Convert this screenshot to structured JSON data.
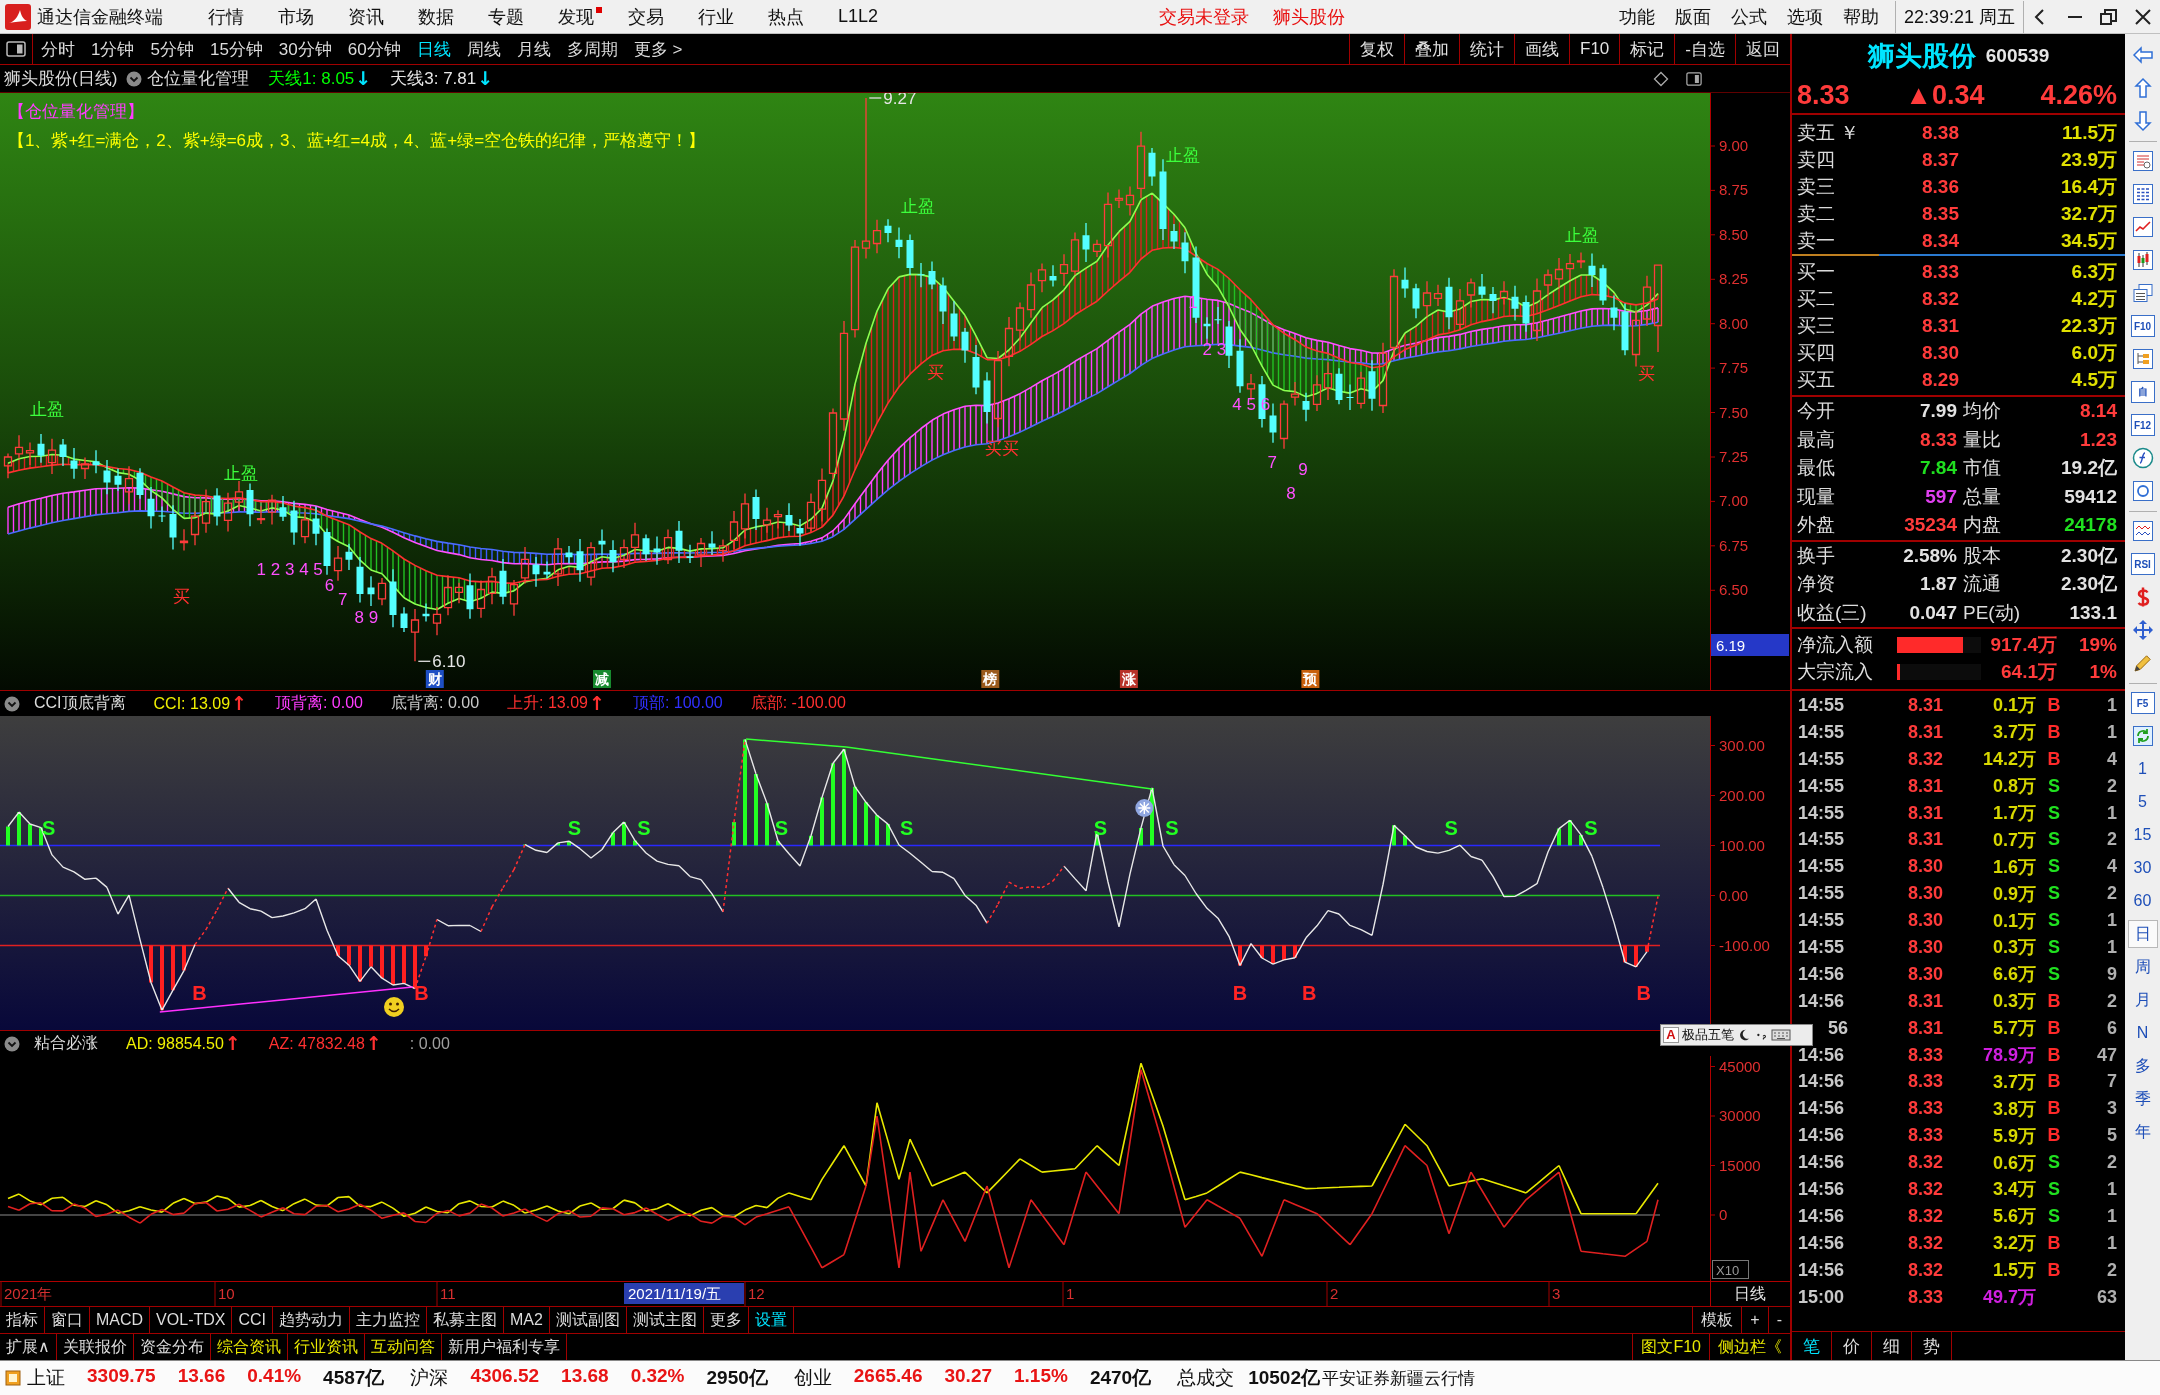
{
  "menu_bar": {
    "title": "通达信金融终端",
    "items": [
      {
        "label": "行情",
        "dot": false
      },
      {
        "label": "市场",
        "dot": false
      },
      {
        "label": "资讯",
        "dot": false
      },
      {
        "label": "数据",
        "dot": false
      },
      {
        "label": "专题",
        "dot": false
      },
      {
        "label": "发现",
        "dot": true
      },
      {
        "label": "交易",
        "dot": false
      },
      {
        "label": "行业",
        "dot": false
      },
      {
        "label": "热点",
        "dot": false
      },
      {
        "label": "L1L2",
        "dot": false
      }
    ],
    "alerts": [
      "交易未登录",
      "狮头股份"
    ],
    "right_items": [
      "功能",
      "版面",
      "公式",
      "选项",
      "帮助"
    ],
    "clock": "22:39:21 周五"
  },
  "period_bar": {
    "periods": [
      {
        "label": "分时",
        "selected": false
      },
      {
        "label": "1分钟",
        "selected": false
      },
      {
        "label": "5分钟",
        "selected": false
      },
      {
        "label": "15分钟",
        "selected": false
      },
      {
        "label": "30分钟",
        "selected": false
      },
      {
        "label": "60分钟",
        "selected": false
      },
      {
        "label": "日线",
        "selected": true
      },
      {
        "label": "周线",
        "selected": false
      },
      {
        "label": "月线",
        "selected": false
      },
      {
        "label": "多周期",
        "selected": false
      },
      {
        "label": "更多 >",
        "selected": false
      }
    ],
    "actions": [
      "复权",
      "叠加",
      "统计",
      "画线",
      "F10",
      "标记",
      "-自选",
      "返回"
    ]
  },
  "price_pane": {
    "title": "狮头股份(日线)",
    "indicator": "仓位量化管理",
    "readouts": [
      {
        "text": "天线1: 8.05",
        "color": "#00ff00",
        "arrow": {
          "text": "↓",
          "color": "#00e5ff"
        }
      },
      {
        "text": "天线3: 7.81",
        "color": "#e6e6e6",
        "arrow": {
          "text": "↓",
          "color": "#00e5ff"
        }
      }
    ],
    "notes": [
      {
        "text": "【仓位量化管理】",
        "color": "#ff3cff"
      },
      {
        "text": "【1、紫+红=满仓，2、紫+绿=6成，3、蓝+红=4成，4、蓝+绿=空仓铁的纪律，严格遵守！】",
        "color": "#ffff00"
      }
    ],
    "annotations": [
      {
        "text": "止盈",
        "kind": "take-profit"
      },
      {
        "text": "买",
        "kind": "buy"
      },
      {
        "text": "止盈",
        "kind": "take-profit"
      },
      {
        "text": "1 2 3 4 5",
        "kind": "count"
      },
      {
        "text": "6",
        "kind": "count"
      },
      {
        "text": "7",
        "kind": "count"
      },
      {
        "text": "8 9",
        "kind": "count"
      },
      {
        "text": "6.10",
        "kind": "price"
      },
      {
        "text": "9.27",
        "kind": "price"
      },
      {
        "text": "止盈",
        "kind": "take-profit"
      },
      {
        "text": "买",
        "kind": "buy"
      },
      {
        "text": "买买",
        "kind": "buy"
      },
      {
        "text": "止盈",
        "kind": "take-profit"
      },
      {
        "text": "1",
        "kind": "count"
      },
      {
        "text": "2 3",
        "kind": "count"
      },
      {
        "text": "4 5 6",
        "kind": "count"
      },
      {
        "text": "7",
        "kind": "count"
      },
      {
        "text": "8",
        "kind": "count"
      },
      {
        "text": "9",
        "kind": "count"
      },
      {
        "text": "止盈",
        "kind": "take-profit"
      },
      {
        "text": "买",
        "kind": "buy"
      }
    ],
    "events": [
      {
        "label": "财",
        "color": "#1e4fc4"
      },
      {
        "label": "减",
        "color": "#178a2e"
      },
      {
        "label": "榜",
        "color": "#9a5a1c"
      },
      {
        "label": "涨",
        "color": "#b83228"
      },
      {
        "label": "预",
        "color": "#c8600c"
      }
    ],
    "y_axis": [
      "9.00",
      "8.75",
      "8.50",
      "8.25",
      "8.00",
      "7.75",
      "7.50",
      "7.25",
      "7.00",
      "6.75",
      "6.50"
    ],
    "cursor_price": "6.19"
  },
  "cci_pane": {
    "title": "CCI顶底背离",
    "readouts": [
      {
        "text": "CCI: 13.09",
        "color": "#f0f000",
        "arrow": {
          "text": "↑",
          "color": "#ff3030"
        }
      },
      {
        "text": "顶背离: 0.00",
        "color": "#ff3cff"
      },
      {
        "text": "底背离: 0.00",
        "color": "#c8c8c8"
      },
      {
        "text": "上升: 13.09",
        "color": "#ff3030",
        "arrow": {
          "text": "↑",
          "color": "#ff3030"
        }
      },
      {
        "text": "顶部: 100.00",
        "color": "#3030ff"
      },
      {
        "text": "底部: -100.00",
        "color": "#ff3030"
      }
    ],
    "signals": [
      {
        "text": "S",
        "kind": "sell"
      },
      {
        "text": "B",
        "kind": "buy"
      },
      {
        "text": "B",
        "kind": "buy"
      },
      {
        "text": "S",
        "kind": "sell"
      },
      {
        "text": "S",
        "kind": "sell"
      },
      {
        "text": "S",
        "kind": "sell"
      },
      {
        "text": "S",
        "kind": "sell"
      },
      {
        "text": "S",
        "kind": "sell"
      },
      {
        "text": "S",
        "kind": "sell"
      },
      {
        "text": "B",
        "kind": "buy"
      },
      {
        "text": "B",
        "kind": "buy"
      },
      {
        "text": "S",
        "kind": "sell"
      },
      {
        "text": "S",
        "kind": "sell"
      },
      {
        "text": "B",
        "kind": "buy"
      }
    ],
    "y_axis": [
      "300.00",
      "200.00",
      "100.00",
      "0.00",
      "-100.00"
    ]
  },
  "ad_pane": {
    "title": "粘合必涨",
    "readouts": [
      {
        "text": "AD: 98854.50",
        "color": "#f0f000",
        "arrow": {
          "text": "↑",
          "color": "#ff3030"
        }
      },
      {
        "text": "AZ: 47832.48",
        "color": "#ff3030",
        "arrow": {
          "text": "↑",
          "color": "#ff3030"
        }
      },
      {
        "text": ": 0.00",
        "color": "#a0a0a0"
      }
    ],
    "y_axis": [
      "45000",
      "30000",
      "15000",
      "0"
    ],
    "scale": "X10"
  },
  "time_axis": {
    "labels": [
      "2021年",
      "10",
      "11",
      "12",
      "1",
      "2",
      "3"
    ],
    "cursor_date": "2021/11/19/五",
    "period": "日线"
  },
  "indicator_tabs": {
    "tabs": [
      {
        "label": "指标",
        "highlighted": false
      },
      {
        "label": "窗口",
        "highlighted": false
      },
      {
        "label": "MACD",
        "highlighted": false
      },
      {
        "label": "VOL-TDX",
        "highlighted": false
      },
      {
        "label": "CCI",
        "highlighted": false
      },
      {
        "label": "趋势动力",
        "highlighted": false
      },
      {
        "label": "主力监控",
        "highlighted": false
      },
      {
        "label": "私募主图",
        "highlighted": false
      },
      {
        "label": "MA2",
        "highlighted": false
      },
      {
        "label": "测试副图",
        "highlighted": false
      },
      {
        "label": "测试主图",
        "highlighted": false
      },
      {
        "label": "更多",
        "highlighted": false
      },
      {
        "label": "设置",
        "highlighted": true
      }
    ],
    "right": [
      "模板",
      "+",
      "-"
    ]
  },
  "info_tabs": {
    "tabs": [
      {
        "label": "扩展∧",
        "highlighted": false
      },
      {
        "label": "关联报价",
        "highlighted": false
      },
      {
        "label": "资金分布",
        "highlighted": false
      },
      {
        "label": "综合资讯",
        "highlighted": true
      },
      {
        "label": "行业资讯",
        "highlighted": true
      },
      {
        "label": "互动问答",
        "highlighted": true
      },
      {
        "label": "新用户福利专享",
        "highlighted": false
      }
    ],
    "right": [
      "图文F10",
      "侧边栏《"
    ]
  },
  "quote": {
    "name": "狮头股份",
    "code": "600539",
    "price": "8.33",
    "change": "▲0.34",
    "percent": "4.26%",
    "up": true,
    "asks": [
      {
        "label": "卖五 ￥",
        "price": "8.38",
        "volume": "11.5万"
      },
      {
        "label": "卖四",
        "price": "8.37",
        "volume": "23.9万"
      },
      {
        "label": "卖三",
        "price": "8.36",
        "volume": "16.4万"
      },
      {
        "label": "卖二",
        "price": "8.35",
        "volume": "32.7万"
      },
      {
        "label": "卖一",
        "price": "8.34",
        "volume": "34.5万"
      }
    ],
    "bids": [
      {
        "label": "买一",
        "price": "8.33",
        "volume": "6.3万"
      },
      {
        "label": "买二",
        "price": "8.32",
        "volume": "4.2万"
      },
      {
        "label": "买三",
        "price": "8.31",
        "volume": "22.3万"
      },
      {
        "label": "买四",
        "price": "8.30",
        "volume": "6.0万"
      },
      {
        "label": "买五",
        "price": "8.29",
        "volume": "4.5万"
      }
    ],
    "stats": [
      [
        {
          "label": "今开",
          "value": "7.99",
          "color": "#e2e2e2"
        },
        {
          "label": "均价",
          "value": "8.14",
          "color": "#ff3b3b"
        }
      ],
      [
        {
          "label": "最高",
          "value": "8.33",
          "color": "#ff3b3b"
        },
        {
          "label": "量比",
          "value": "1.23",
          "color": "#ff3b3b"
        }
      ],
      [
        {
          "label": "最低",
          "value": "7.84",
          "color": "#20e020"
        },
        {
          "label": "市值",
          "value": "19.2亿",
          "color": "#e2e2e2"
        }
      ],
      [
        {
          "label": "现量",
          "value": "597",
          "color": "#e040f0"
        },
        {
          "label": "总量",
          "value": "59412",
          "color": "#e2e2e2"
        }
      ],
      [
        {
          "label": "外盘",
          "value": "35234",
          "color": "#ff3b3b"
        },
        {
          "label": "内盘",
          "value": "24178",
          "color": "#20e020"
        }
      ]
    ],
    "fundamentals": [
      [
        {
          "label": "换手",
          "value": "2.58%"
        },
        {
          "label": "股本",
          "value": "2.30亿"
        }
      ],
      [
        {
          "label": "净资",
          "value": "1.87"
        },
        {
          "label": "流通",
          "value": "2.30亿"
        }
      ],
      [
        {
          "label": "收益(三)",
          "value": "0.047"
        },
        {
          "label": "PE(动)",
          "value": "133.1"
        }
      ]
    ],
    "flows": [
      {
        "label": "净流入额",
        "level": 0.79,
        "amount": "917.4万",
        "percent": "19%"
      },
      {
        "label": "大宗流入",
        "level": 0.04,
        "amount": "64.1万",
        "percent": "1%"
      }
    ],
    "trades": [
      {
        "time": "14:55",
        "price": "8.31",
        "volume": "0.1万",
        "side": "B",
        "buy": true,
        "count": "1",
        "large": false
      },
      {
        "time": "14:55",
        "price": "8.31",
        "volume": "3.7万",
        "side": "B",
        "buy": true,
        "count": "1",
        "large": false
      },
      {
        "time": "14:55",
        "price": "8.32",
        "volume": "14.2万",
        "side": "B",
        "buy": true,
        "count": "4",
        "large": false
      },
      {
        "time": "14:55",
        "price": "8.31",
        "volume": "0.8万",
        "side": "S",
        "buy": false,
        "count": "2",
        "large": false
      },
      {
        "time": "14:55",
        "price": "8.31",
        "volume": "1.7万",
        "side": "S",
        "buy": false,
        "count": "1",
        "large": false
      },
      {
        "time": "14:55",
        "price": "8.31",
        "volume": "0.7万",
        "side": "S",
        "buy": false,
        "count": "2",
        "large": false
      },
      {
        "time": "14:55",
        "price": "8.30",
        "volume": "1.6万",
        "side": "S",
        "buy": false,
        "count": "4",
        "large": false
      },
      {
        "time": "14:55",
        "price": "8.30",
        "volume": "0.9万",
        "side": "S",
        "buy": false,
        "count": "2",
        "large": false
      },
      {
        "time": "14:55",
        "price": "8.30",
        "volume": "0.1万",
        "side": "S",
        "buy": false,
        "count": "1",
        "large": false
      },
      {
        "time": "14:55",
        "price": "8.30",
        "volume": "0.3万",
        "side": "S",
        "buy": false,
        "count": "1",
        "large": false
      },
      {
        "time": "14:56",
        "price": "8.30",
        "volume": "6.6万",
        "side": "S",
        "buy": false,
        "count": "9",
        "large": false
      },
      {
        "time": "14:56",
        "price": "8.31",
        "volume": "0.3万",
        "side": "B",
        "buy": true,
        "count": "2",
        "large": false
      },
      {
        "time": "56",
        "price": "8.31",
        "volume": "5.7万",
        "side": "B",
        "buy": true,
        "count": "6",
        "large": false
      },
      {
        "time": "14:56",
        "price": "8.33",
        "volume": "78.9万",
        "side": "B",
        "buy": true,
        "count": "47",
        "large": true
      },
      {
        "time": "14:56",
        "price": "8.33",
        "volume": "3.7万",
        "side": "B",
        "buy": true,
        "count": "7",
        "large": false
      },
      {
        "time": "14:56",
        "price": "8.33",
        "volume": "3.8万",
        "side": "B",
        "buy": true,
        "count": "3",
        "large": false
      },
      {
        "time": "14:56",
        "price": "8.33",
        "volume": "5.9万",
        "side": "B",
        "buy": true,
        "count": "5",
        "large": false
      },
      {
        "time": "14:56",
        "price": "8.32",
        "volume": "0.6万",
        "side": "S",
        "buy": false,
        "count": "2",
        "large": false
      },
      {
        "time": "14:56",
        "price": "8.32",
        "volume": "3.4万",
        "side": "S",
        "buy": false,
        "count": "1",
        "large": false
      },
      {
        "time": "14:56",
        "price": "8.32",
        "volume": "5.6万",
        "side": "S",
        "buy": false,
        "count": "1",
        "large": false
      },
      {
        "time": "14:56",
        "price": "8.32",
        "volume": "3.2万",
        "side": "B",
        "buy": true,
        "count": "1",
        "large": false
      },
      {
        "time": "14:56",
        "price": "8.32",
        "volume": "1.5万",
        "side": "B",
        "buy": true,
        "count": "2",
        "large": false
      },
      {
        "time": "15:00",
        "price": "8.33",
        "volume": "49.7万",
        "count": "63",
        "large": true
      }
    ],
    "tabs": [
      {
        "label": "笔",
        "selected": true
      },
      {
        "label": "价",
        "selected": false
      },
      {
        "label": "细",
        "selected": false
      },
      {
        "label": "势",
        "selected": false
      }
    ]
  },
  "side_toolbar": {
    "buttons": [
      "F10",
      "自",
      "F12",
      "RSI",
      "F5"
    ],
    "periods": [
      {
        "label": "1",
        "selected": false
      },
      {
        "label": "5",
        "selected": false
      },
      {
        "label": "15",
        "selected": false
      },
      {
        "label": "30",
        "selected": false
      },
      {
        "label": "60",
        "selected": false
      },
      {
        "label": "日",
        "selected": true
      },
      {
        "label": "周",
        "selected": false
      },
      {
        "label": "月",
        "selected": false
      },
      {
        "label": "N",
        "selected": false
      },
      {
        "label": "多",
        "selected": false
      },
      {
        "label": "季",
        "selected": false
      },
      {
        "label": "年",
        "selected": false
      }
    ]
  },
  "ime_toolbar": {
    "mode": "A",
    "label": "极品五笔"
  },
  "status_bar": {
    "indices": [
      {
        "name": "上证",
        "value": "3309.75",
        "change": "13.66",
        "percent": "0.41%",
        "amount": "4587亿",
        "up": true
      },
      {
        "name": "沪深",
        "value": "4306.52",
        "change": "13.68",
        "percent": "0.32%",
        "amount": "2950亿",
        "up": true
      },
      {
        "name": "创业",
        "value": "2665.46",
        "change": "30.27",
        "percent": "1.15%",
        "amount": "2470亿",
        "up": true
      }
    ],
    "total_label": "总成交",
    "total": "10502亿",
    "broker": "平安证券新疆云行情"
  }
}
